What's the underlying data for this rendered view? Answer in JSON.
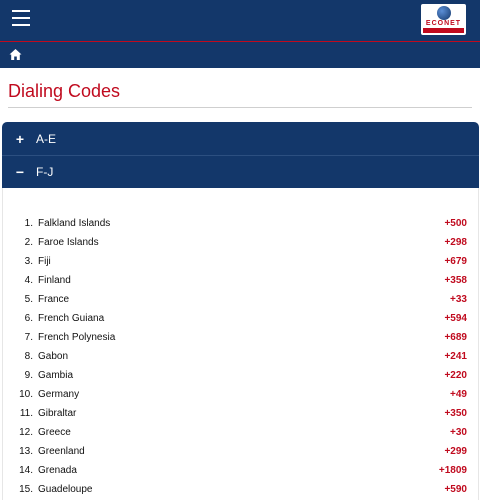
{
  "header": {
    "logo_text": "ECONET",
    "logo_tagline": "WIRELESS",
    "menu_icon": "hamburger-icon",
    "home_icon": "home-icon"
  },
  "page": {
    "title": "Dialing Codes"
  },
  "accordion": {
    "sections": [
      {
        "label": "A-E",
        "icon": "plus-icon",
        "symbol": "+",
        "expanded": false
      },
      {
        "label": "F-J",
        "icon": "minus-icon",
        "symbol": "−",
        "expanded": true
      }
    ]
  },
  "countries": [
    {
      "num": "1.",
      "name": "Falkland Islands",
      "code": "+500"
    },
    {
      "num": "2.",
      "name": "Faroe Islands",
      "code": "+298"
    },
    {
      "num": "3.",
      "name": "Fiji",
      "code": "+679"
    },
    {
      "num": "4.",
      "name": "Finland",
      "code": "+358"
    },
    {
      "num": "5.",
      "name": "France",
      "code": "+33"
    },
    {
      "num": "6.",
      "name": "French Guiana",
      "code": "+594"
    },
    {
      "num": "7.",
      "name": "French Polynesia",
      "code": "+689"
    },
    {
      "num": "8.",
      "name": "Gabon",
      "code": "+241"
    },
    {
      "num": "9.",
      "name": "Gambia",
      "code": "+220"
    },
    {
      "num": "10.",
      "name": "Germany",
      "code": "+49"
    },
    {
      "num": "11.",
      "name": "Gibraltar",
      "code": "+350"
    },
    {
      "num": "12.",
      "name": "Greece",
      "code": "+30"
    },
    {
      "num": "13.",
      "name": "Greenland",
      "code": "+299"
    },
    {
      "num": "14.",
      "name": "Grenada",
      "code": "+1809"
    },
    {
      "num": "15.",
      "name": "Guadeloupe",
      "code": "+590"
    }
  ],
  "colors": {
    "brand_blue": "#13376a",
    "brand_red": "#c00a1e"
  }
}
